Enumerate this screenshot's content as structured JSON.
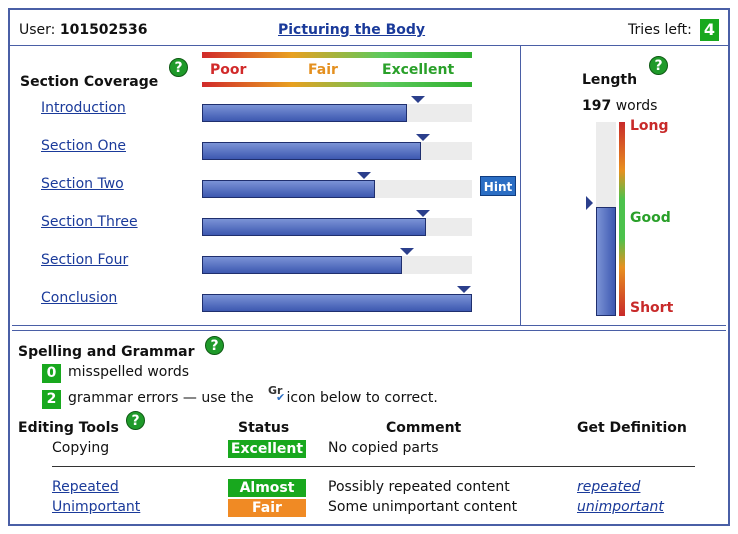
{
  "header": {
    "user_label": "User:",
    "user_id": "101502536",
    "title": "Picturing the Body",
    "tries_label": "Tries left:",
    "tries_value": "4"
  },
  "coverage": {
    "heading": "Section Coverage",
    "help_glyph": "?",
    "scale": {
      "poor": "Poor",
      "fair": "Fair",
      "excellent": "Excellent"
    },
    "sections": [
      {
        "label": "Introduction",
        "fill": 0.76,
        "target": 0.8
      },
      {
        "label": "Section One",
        "fill": 0.81,
        "target": 0.82
      },
      {
        "label": "Section Two",
        "fill": 0.64,
        "target": 0.6
      },
      {
        "label": "Section Three",
        "fill": 0.83,
        "target": 0.82
      },
      {
        "label": "Section Four",
        "fill": 0.74,
        "target": 0.76
      },
      {
        "label": "Conclusion",
        "fill": 1.0,
        "target": 0.97
      }
    ],
    "hint_label": "Hint"
  },
  "length": {
    "heading": "Length",
    "count": "197",
    "count_unit": "words",
    "fill": 0.56,
    "labels": {
      "long": "Long",
      "good": "Good",
      "short": "Short"
    }
  },
  "spelling": {
    "heading": "Spelling and Grammar",
    "misspelled_count": "0",
    "misspelled_text": "misspelled words",
    "grammar_count": "2",
    "grammar_text_before": "grammar errors — use the",
    "grammar_icon_text": "Gr",
    "grammar_text_after": "icon below to correct."
  },
  "editing": {
    "heading": "Editing Tools",
    "columns": {
      "status": "Status",
      "comment": "Comment",
      "definition": "Get Definition"
    },
    "copying": {
      "label": "Copying",
      "status": "Excellent",
      "comment": "No copied parts"
    },
    "repeated": {
      "label": "Repeated",
      "status": "Almost",
      "comment": "Possibly repeated content",
      "definition": "repeated"
    },
    "unimportant": {
      "label": "Unimportant",
      "status": "Fair",
      "comment": "Some unimportant content",
      "definition": "unimportant"
    }
  },
  "colors": {
    "excellent": "#18a81e",
    "almost": "#18a81e",
    "fair": "#f08a24",
    "link": "#1a3a9a",
    "bar": "#3d58b0"
  }
}
